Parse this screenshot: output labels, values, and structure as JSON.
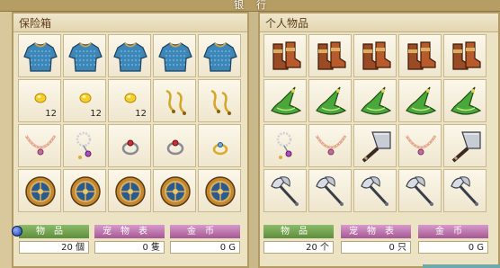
{
  "window": {
    "title": "银行"
  },
  "vault": {
    "title": "保险箱",
    "items": [
      {
        "icon": "chainmail-armor-icon"
      },
      {
        "icon": "chainmail-armor-icon"
      },
      {
        "icon": "chainmail-armor-icon"
      },
      {
        "icon": "chainmail-armor-icon"
      },
      {
        "icon": "chainmail-armor-icon"
      },
      {
        "icon": "gold-coin-icon",
        "qty": "12"
      },
      {
        "icon": "gold-coin-icon",
        "qty": "12"
      },
      {
        "icon": "gold-coin-icon",
        "qty": "12"
      },
      {
        "icon": "gold-earrings-icon"
      },
      {
        "icon": "gold-earrings-icon"
      },
      {
        "icon": "necklace-icon"
      },
      {
        "icon": "pearl-necklace-icon"
      },
      {
        "icon": "ruby-ring-icon"
      },
      {
        "icon": "ruby-ring-icon"
      },
      {
        "icon": "gold-ring-icon"
      },
      {
        "icon": "round-shield-icon"
      },
      {
        "icon": "round-shield-icon"
      },
      {
        "icon": "round-shield-icon"
      },
      {
        "icon": "round-shield-icon"
      },
      {
        "icon": "round-shield-icon"
      }
    ],
    "stats": {
      "items_label": "物品",
      "items_value": "20 個",
      "pets_label": "宠物表",
      "pets_value": "0 隻",
      "gold_label": "金币",
      "gold_value": "0 G"
    }
  },
  "inventory": {
    "title": "个人物品",
    "items": [
      {
        "icon": "leather-boots-icon"
      },
      {
        "icon": "leather-boots-icon"
      },
      {
        "icon": "leather-boots-icon"
      },
      {
        "icon": "leather-boots-icon"
      },
      {
        "icon": "leather-boots-icon"
      },
      {
        "icon": "green-wizard-hat-icon"
      },
      {
        "icon": "green-wizard-hat-icon"
      },
      {
        "icon": "green-wizard-hat-icon"
      },
      {
        "icon": "green-wizard-hat-icon"
      },
      {
        "icon": "green-wizard-hat-icon"
      },
      {
        "icon": "pearl-necklace-icon"
      },
      {
        "icon": "necklace-icon"
      },
      {
        "icon": "cleaver-blade-icon"
      },
      {
        "icon": "necklace-icon"
      },
      {
        "icon": "cleaver-blade-icon"
      },
      {
        "icon": "battle-axe-icon"
      },
      {
        "icon": "battle-axe-icon"
      },
      {
        "icon": "battle-axe-icon"
      },
      {
        "icon": "battle-axe-icon"
      },
      {
        "icon": "battle-axe-icon"
      }
    ],
    "stats": {
      "items_label": "物品",
      "items_value": "20 个",
      "pets_label": "宠物表",
      "pets_value": "0 只",
      "gold_label": "金币",
      "gold_value": "0 G"
    }
  }
}
